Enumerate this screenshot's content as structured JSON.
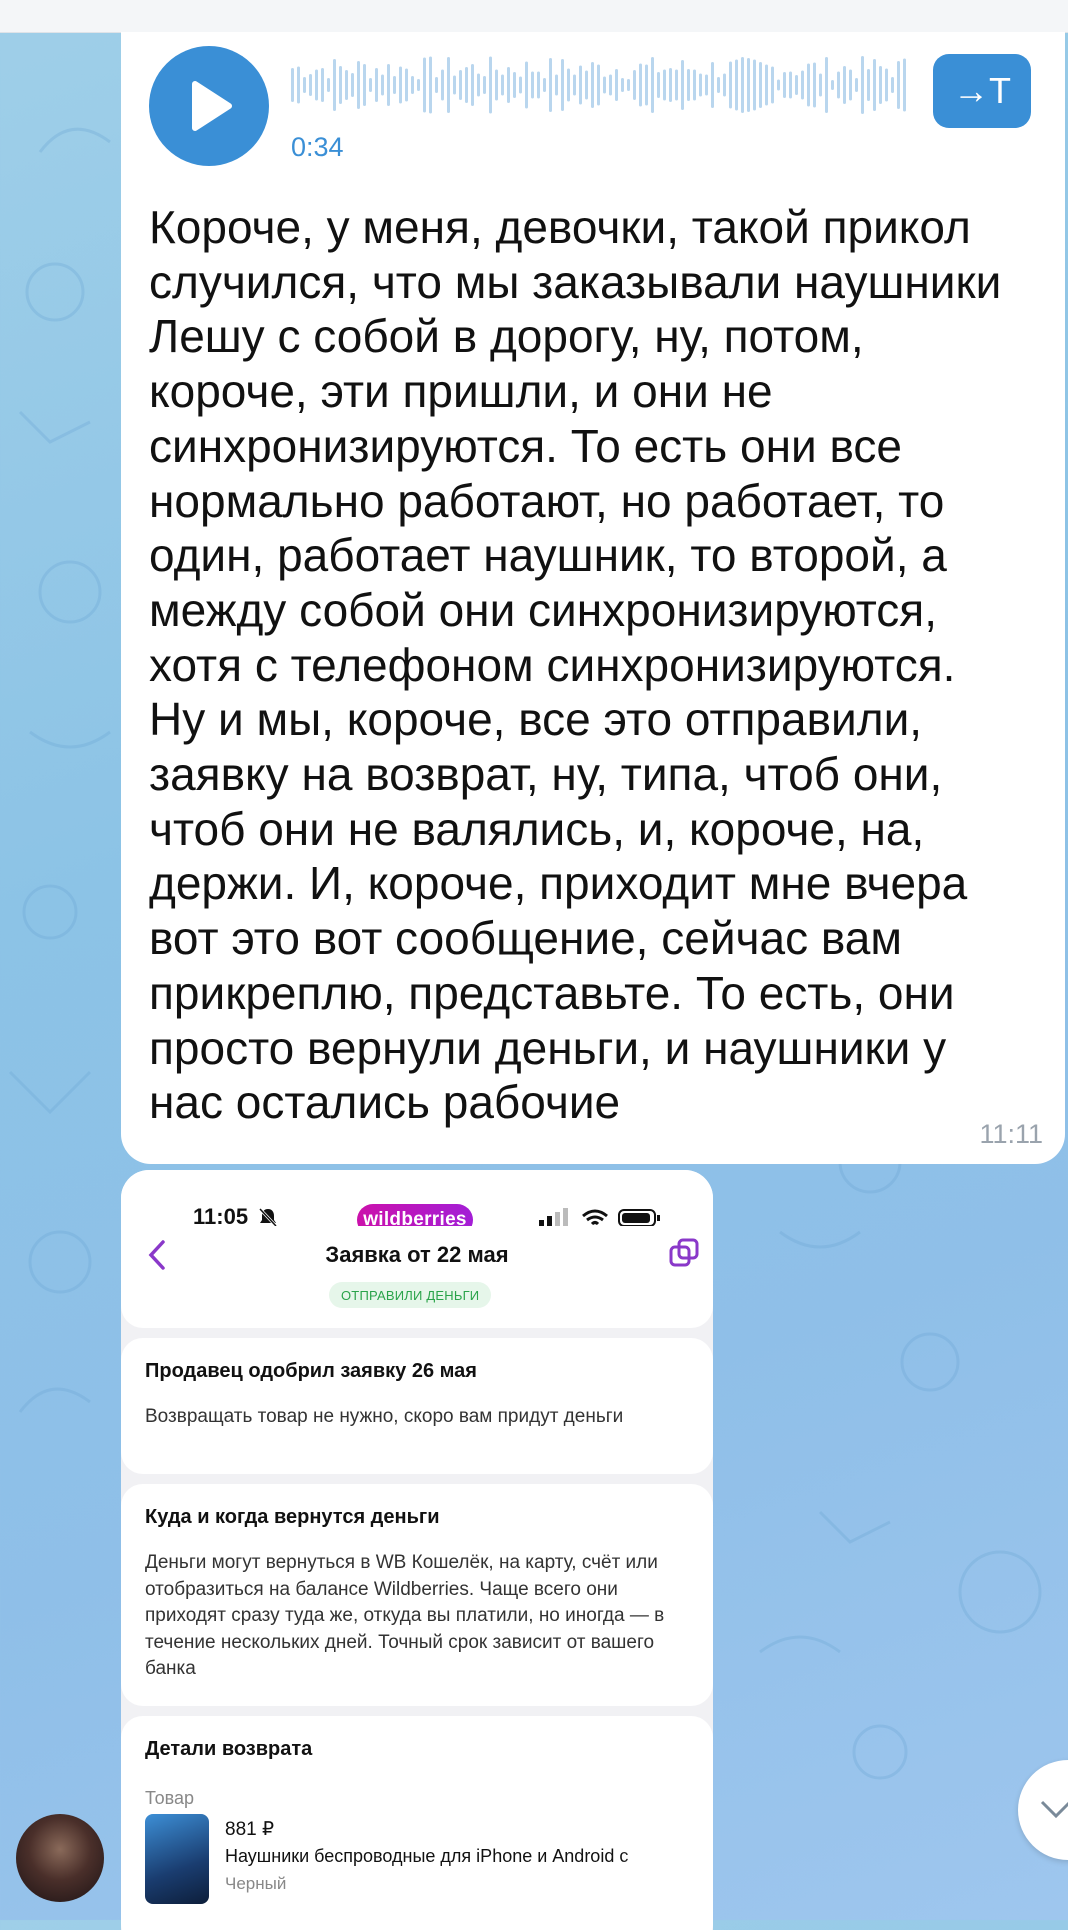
{
  "voice_message": {
    "duration": "0:34",
    "transcribe_label": "→T",
    "transcript_lines": [
      "Короче, у меня, девочки, такой прикол",
      "случился, что мы заказывали наушники",
      "Лешу с собой в дорогу, ну, потом,",
      "короче, эти пришли, и они не",
      "синхронизируются. То есть они все",
      "нормально работают, но работает, то",
      "один, работает наушник, то второй, а",
      "между собой они синхронизируются,",
      "хотя с телефоном синхронизируются.",
      "Ну и мы, короче, все это отправили,",
      "заявку на возврат, ну, типа, чтоб они,",
      "чтоб они не валялись, и, короче, на,",
      "держи. И, короче, приходит мне вчера",
      "вот это вот сообщение, сейчас вам",
      "прикреплю, представьте. То есть, они",
      "просто вернули деньги, и наушники у",
      "нас остались рабочие"
    ],
    "time": "11:11"
  },
  "screenshot": {
    "status_time": "11:05",
    "brand": "wildberries",
    "order_title": "Заявка от 22 мая",
    "status_badge": "ОТПРАВИЛИ ДЕНЬГИ",
    "approved": {
      "title": "Продавец одобрил заявку 26 мая",
      "text": "Возвращать товар не нужно, скоро вам придут деньги"
    },
    "refund_info": {
      "title": "Куда и когда вернутся деньги",
      "text": "Деньги могут вернуться в WB Кошелёк, на карту, счёт или отобразиться на балансе Wildberries. Чаще всего они приходят сразу туда же, откуда вы платили, но иногда — в течение нескольких дней. Точный срок зависит от вашего банка"
    },
    "return_details": {
      "title": "Детали возврата",
      "product_label": "Товар",
      "price": "881 ₽",
      "name": "Наушники беспроводные для iPhone и Android с",
      "color": "Черный"
    }
  },
  "colors": {
    "accent": "#3a8fd6",
    "wb_brand": "#cb11ab",
    "status_green": "#2aa34a"
  },
  "icons": [
    "play-icon",
    "transcribe-icon",
    "bell-off-icon",
    "signal-icon",
    "wifi-icon",
    "battery-icon",
    "back-icon",
    "copy-icon",
    "avatar",
    "scroll-down-icon"
  ]
}
